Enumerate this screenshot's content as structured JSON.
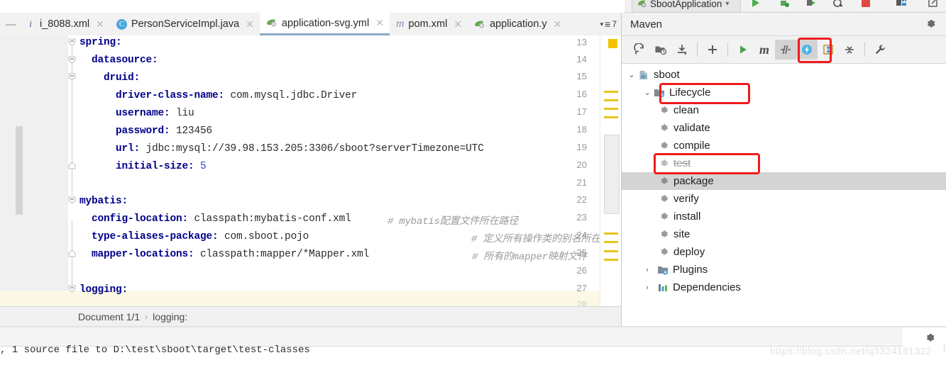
{
  "window": {
    "run_config": "SbootApplication",
    "run_config_caret": "▾"
  },
  "run_toolbar": [
    {
      "name": "run-button",
      "glyph": "▶"
    },
    {
      "name": "debug-button",
      "glyph": "🐞"
    },
    {
      "name": "run-with-coverage-button",
      "glyph": "▶"
    },
    {
      "name": "profiler-button",
      "glyph": "◔"
    },
    {
      "name": "stop-button",
      "glyph": "■"
    },
    {
      "name": "layout-button",
      "glyph": "▤"
    },
    {
      "name": "external-button",
      "glyph": "⧉"
    }
  ],
  "tabs": {
    "minus_label": "—",
    "items": [
      {
        "label": "i_8088.xml",
        "icon": "xml-file-icon",
        "selected": false,
        "close": "✕"
      },
      {
        "label": "PersonServiceImpl.java",
        "icon": "java-class-icon",
        "selected": false,
        "close": "✕"
      },
      {
        "label": "application-svg.yml",
        "icon": "yaml-spring-file-icon",
        "selected": true,
        "close": "✕"
      },
      {
        "label": "pom.xml",
        "icon": "maven-pom-icon",
        "selected": false,
        "close": "✕"
      },
      {
        "label": "application.y",
        "icon": "yaml-spring-file-icon",
        "selected": false,
        "close": "✕"
      }
    ],
    "overflow_caret": "▾",
    "overflow_icon": "≡",
    "overflow_count": "7"
  },
  "editor": {
    "line_numbers": [
      "13",
      "14",
      "15",
      "16",
      "17",
      "18",
      "19",
      "20",
      "21",
      "22",
      "23",
      "24",
      "25",
      "26",
      "27",
      "28"
    ],
    "lines": [
      {
        "n": "13",
        "indent": 0,
        "key": "spring",
        "colon": ":",
        "value": "",
        "comment": "",
        "fold": "minus-open"
      },
      {
        "n": "14",
        "indent": 1,
        "key": "datasource",
        "colon": ":",
        "value": "",
        "comment": "",
        "fold": "minus-open"
      },
      {
        "n": "15",
        "indent": 2,
        "key": "druid",
        "colon": ":",
        "value": "",
        "comment": "",
        "fold": "minus-open"
      },
      {
        "n": "16",
        "indent": 3,
        "key": "driver-class-name",
        "colon": ":",
        "value": " com.mysql.jdbc.Driver",
        "comment": "",
        "fold": ""
      },
      {
        "n": "17",
        "indent": 3,
        "key": "username",
        "colon": ":",
        "value": " liu",
        "comment": "",
        "fold": ""
      },
      {
        "n": "18",
        "indent": 3,
        "key": "password",
        "colon": ":",
        "value": " 123456",
        "comment": "",
        "fold": ""
      },
      {
        "n": "19",
        "indent": 3,
        "key": "url",
        "colon": ":",
        "value": " jdbc:mysql://39.98.153.205:3306/sboot?serverTimezone=UTC",
        "comment": "",
        "fold": ""
      },
      {
        "n": "20",
        "indent": 3,
        "key": "initial-size",
        "colon": ":",
        "value": " 5",
        "number": true,
        "comment": "",
        "fold": "end"
      },
      {
        "n": "21",
        "indent": 0,
        "key": "",
        "colon": "",
        "value": "",
        "comment": "",
        "fold": ""
      },
      {
        "n": "22",
        "indent": 0,
        "key": "mybatis",
        "colon": ":",
        "value": "",
        "comment": "",
        "fold": "minus-open"
      },
      {
        "n": "23",
        "indent": 1,
        "key": "config-location",
        "colon": ":",
        "value": " classpath:mybatis-conf.xml",
        "comment": "# mybatis配置文件所在路径",
        "fold": ""
      },
      {
        "n": "24",
        "indent": 1,
        "key": "type-aliases-package",
        "colon": ":",
        "value": " com.sboot.pojo",
        "comment": "# 定义所有操作类的别名所在包",
        "fold": ""
      },
      {
        "n": "25",
        "indent": 1,
        "key": "mapper-locations",
        "colon": ":",
        "value": " classpath:mapper/*Mapper.xml",
        "comment": "# 所有的mapper映射文件",
        "fold": "end"
      },
      {
        "n": "26",
        "indent": 0,
        "key": "",
        "colon": "",
        "value": "",
        "comment": "",
        "fold": ""
      },
      {
        "n": "27",
        "indent": 0,
        "key": "logging",
        "colon": ":",
        "value": "",
        "comment": "",
        "fold": "minus-open"
      },
      {
        "n": "28",
        "indent": 0,
        "key": "",
        "colon": "",
        "value": "",
        "comment": "",
        "fold": ""
      }
    ]
  },
  "breadcrumb": {
    "document": "Document 1/1",
    "separator": "›",
    "node": "logging:"
  },
  "maven": {
    "title": "Maven",
    "settings_icon": "gear-icon",
    "toolbar": [
      {
        "name": "reload-all-maven-projects-button",
        "glyph": "⟳"
      },
      {
        "name": "generate-sources-button",
        "glyph": "▣"
      },
      {
        "name": "download-sources-button",
        "glyph": "⤓"
      },
      {
        "name": "add-maven-project-button",
        "glyph": "＋"
      },
      {
        "name": "execute-maven-goal-button",
        "glyph": "▶"
      },
      {
        "name": "maven-settings-button",
        "glyph": "m"
      },
      {
        "name": "toggle-skip-tests-button",
        "glyph": "⫽"
      },
      {
        "name": "toggle-offline-mode-button",
        "glyph": "⚡"
      },
      {
        "name": "expand-all-button",
        "glyph": "⇕"
      },
      {
        "name": "collapse-all-button",
        "glyph": "⤒"
      },
      {
        "name": "maven-config-button",
        "glyph": "🔧"
      }
    ],
    "tree": {
      "root": {
        "label": "sboot",
        "chevron": "⌄",
        "icon": "maven-project-icon"
      },
      "lifecycle": {
        "label": "Lifecycle",
        "chevron": "⌄",
        "icon": "lifecycle-folder-icon"
      },
      "goals": [
        {
          "label": "clean",
          "icon": "maven-goal-icon",
          "highlighted": true,
          "selected": false,
          "disabled": false
        },
        {
          "label": "validate",
          "icon": "maven-goal-icon",
          "highlighted": false,
          "selected": false,
          "disabled": false
        },
        {
          "label": "compile",
          "icon": "maven-goal-icon",
          "highlighted": false,
          "selected": false,
          "disabled": false
        },
        {
          "label": "test",
          "icon": "maven-goal-icon",
          "highlighted": false,
          "selected": false,
          "disabled": true
        },
        {
          "label": "package",
          "icon": "maven-goal-icon",
          "highlighted": true,
          "selected": true,
          "disabled": false
        },
        {
          "label": "verify",
          "icon": "maven-goal-icon",
          "highlighted": false,
          "selected": false,
          "disabled": false
        },
        {
          "label": "install",
          "icon": "maven-goal-icon",
          "highlighted": false,
          "selected": false,
          "disabled": false
        },
        {
          "label": "site",
          "icon": "maven-goal-icon",
          "highlighted": false,
          "selected": false,
          "disabled": false
        },
        {
          "label": "deploy",
          "icon": "maven-goal-icon",
          "highlighted": false,
          "selected": false,
          "disabled": false
        }
      ],
      "plugins": {
        "label": "Plugins",
        "chevron": "›",
        "icon": "plugins-folder-icon"
      },
      "dependencies": {
        "label": "Dependencies",
        "chevron": "›",
        "icon": "dependencies-icon"
      }
    }
  },
  "console": {
    "text": ", 1 source file to D:\\test\\sboot\\target\\test-classes",
    "settings_icon": "gear-icon",
    "more_icon": "⋮"
  },
  "watermark": "https://blog.csdn.net/q3324181322",
  "colors": {
    "highlight_red": "#f01b1b",
    "selection_gray": "#d4d4d4",
    "tab_selected_underline": "#8fa9c4",
    "keyword_blue": "#00008b",
    "marker_yellow": "#e8c51e",
    "green_run": "#4caf50"
  }
}
